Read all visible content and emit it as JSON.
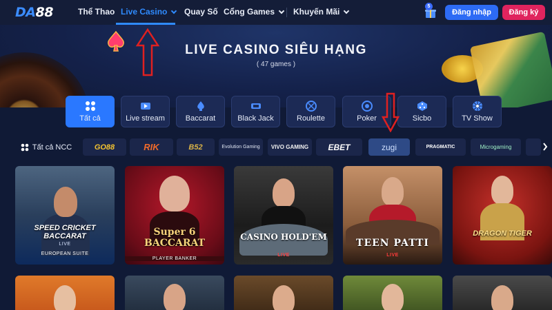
{
  "nav": {
    "logo_prefix": "DA",
    "logo_suffix": "88",
    "items": [
      {
        "label": "Thể Thao"
      },
      {
        "label": "Live Casino"
      },
      {
        "label": "Quay Số"
      },
      {
        "label": "Cổng Games"
      },
      {
        "label": "Khuyến Mãi"
      }
    ],
    "gift_badge": "5",
    "login_label": "Đăng nhập",
    "register_label": "Đăng ký"
  },
  "hero": {
    "title": "LIVE CASINO SIÊU HẠNG",
    "subtitle": "( 47 games )"
  },
  "categories": [
    {
      "label": "Tất cả",
      "icon": "grid-icon"
    },
    {
      "label": "Live stream",
      "icon": "tv-play-icon"
    },
    {
      "label": "Baccarat",
      "icon": "baccarat-icon"
    },
    {
      "label": "Black Jack",
      "icon": "blackjack-icon"
    },
    {
      "label": "Roulette",
      "icon": "roulette-icon"
    },
    {
      "label": "Poker",
      "icon": "poker-chip-icon"
    },
    {
      "label": "Sicbo",
      "icon": "dice-icon"
    },
    {
      "label": "TV Show",
      "icon": "wheel-icon"
    }
  ],
  "providers": [
    {
      "label": "Tất cả NCC"
    },
    {
      "label": "GO88"
    },
    {
      "label": "RIK"
    },
    {
      "label": "B52"
    },
    {
      "label": "Evolution Gaming"
    },
    {
      "label": "VIVO GAMING"
    },
    {
      "label": "EBET"
    },
    {
      "label": "zugi"
    },
    {
      "label": "PRAGMATIC"
    },
    {
      "label": "Microgaming"
    }
  ],
  "games": [
    {
      "title": "SPEED CRICKET BACCARAT",
      "badge": "LIVE",
      "sub": "EUROPEAN SUITE"
    },
    {
      "title": "Super 6 BACCARAT",
      "sub": "PLAYER     BANKER"
    },
    {
      "title": "CASINO HOLD'EM",
      "badge": "LIVE"
    },
    {
      "title": "TEEN PATTI",
      "badge": "LIVE"
    },
    {
      "title": "DRAGON TIGER"
    }
  ],
  "colors": {
    "accent": "#2f8bff",
    "login": "#2d6bf5",
    "register": "#e0245e",
    "annotation_arrow": "#e02020"
  }
}
